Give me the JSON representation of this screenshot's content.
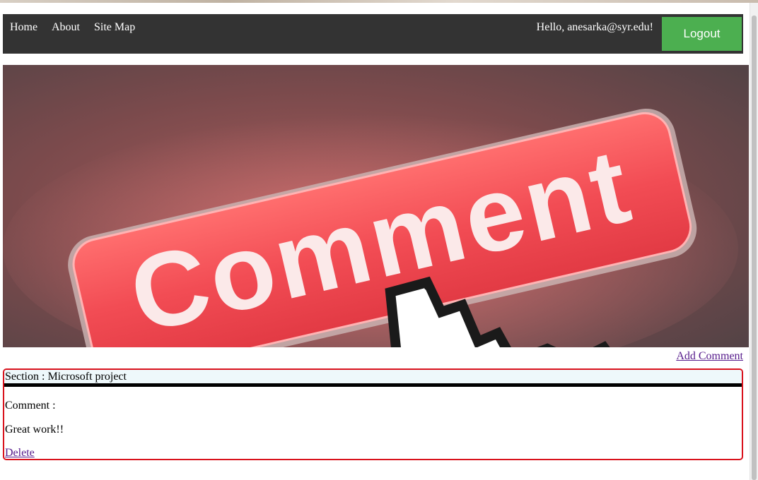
{
  "nav": {
    "links": [
      "Home",
      "About",
      "Site Map"
    ],
    "greeting": "Hello, anesarka@syr.edu!",
    "logout_label": "Logout"
  },
  "banner": {
    "image_text": "Comment",
    "image_description": "Red glowing button with a pointing hand cursor"
  },
  "actions": {
    "add_comment": "Add Comment"
  },
  "comment": {
    "section": "Section : Microsoft project",
    "label": "Comment :",
    "text": "Great work!!",
    "delete_label": "Delete"
  },
  "colors": {
    "navbar": "#333333",
    "logout": "#4caf50",
    "card_border": "#d9121c",
    "link": "#551a8b"
  }
}
